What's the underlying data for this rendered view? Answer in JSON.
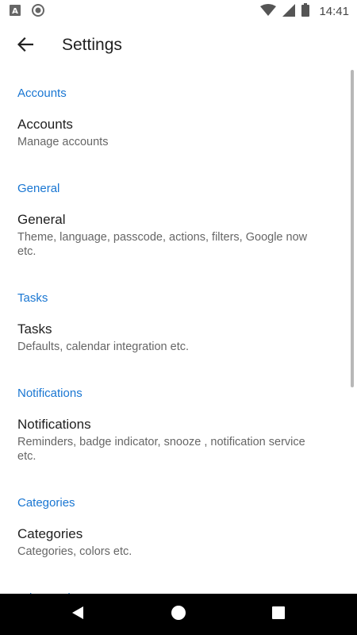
{
  "status_bar": {
    "time": "14:41",
    "icons": [
      "font-a-icon",
      "record-icon",
      "wifi-icon",
      "signal-icon",
      "battery-icon"
    ]
  },
  "app_bar": {
    "title": "Settings",
    "back_icon": "arrow-back-icon"
  },
  "sections": [
    {
      "header": "Accounts",
      "title": "Accounts",
      "summary": "Manage accounts"
    },
    {
      "header": "General",
      "title": "General",
      "summary": "Theme, language, passcode, actions, filters, Google now etc."
    },
    {
      "header": "Tasks",
      "title": "Tasks",
      "summary": "Defaults, calendar integration etc."
    },
    {
      "header": "Notifications",
      "title": "Notifications",
      "summary": "Reminders, badge indicator, snooze , notification service etc."
    },
    {
      "header": "Categories",
      "title": "Categories",
      "summary": "Categories, colors etc."
    },
    {
      "header": "Advanced",
      "title": "",
      "summary": ""
    }
  ],
  "nav_bar": {
    "buttons": [
      "back-triangle-icon",
      "home-circle-icon",
      "recents-square-icon"
    ]
  },
  "colors": {
    "accent": "#1976d2",
    "title_text": "#212121",
    "summary_text": "#666666"
  }
}
